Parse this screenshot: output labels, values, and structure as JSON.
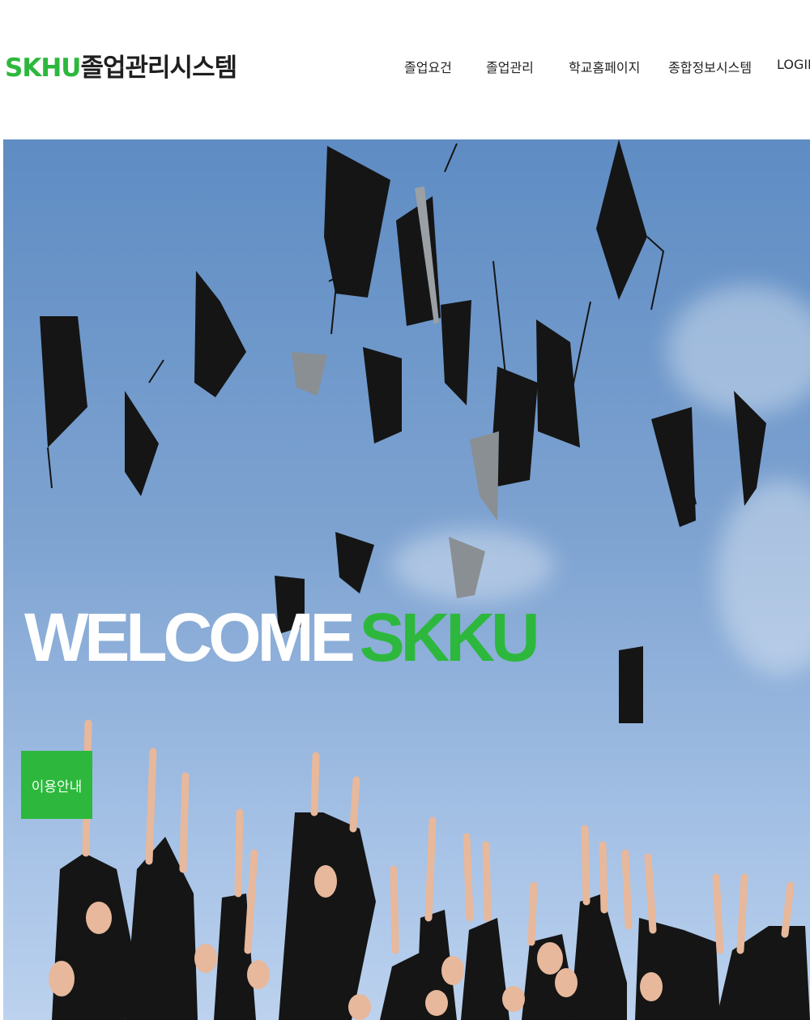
{
  "header": {
    "logo_accent": "SKHU",
    "logo_text": "졸업관리시스템"
  },
  "nav": {
    "items": [
      {
        "label": "졸업요건"
      },
      {
        "label": "졸업관리"
      },
      {
        "label": "학교홈페이지"
      },
      {
        "label": "종합정보시스템"
      },
      {
        "label": "LOGIN"
      }
    ]
  },
  "hero": {
    "welcome_text": "WELCOME",
    "welcome_accent": "SKKU",
    "guide_button_label": "이용안내"
  },
  "colors": {
    "accent": "#2db83d",
    "sky": "#6f97c9",
    "gown": "#151515"
  }
}
